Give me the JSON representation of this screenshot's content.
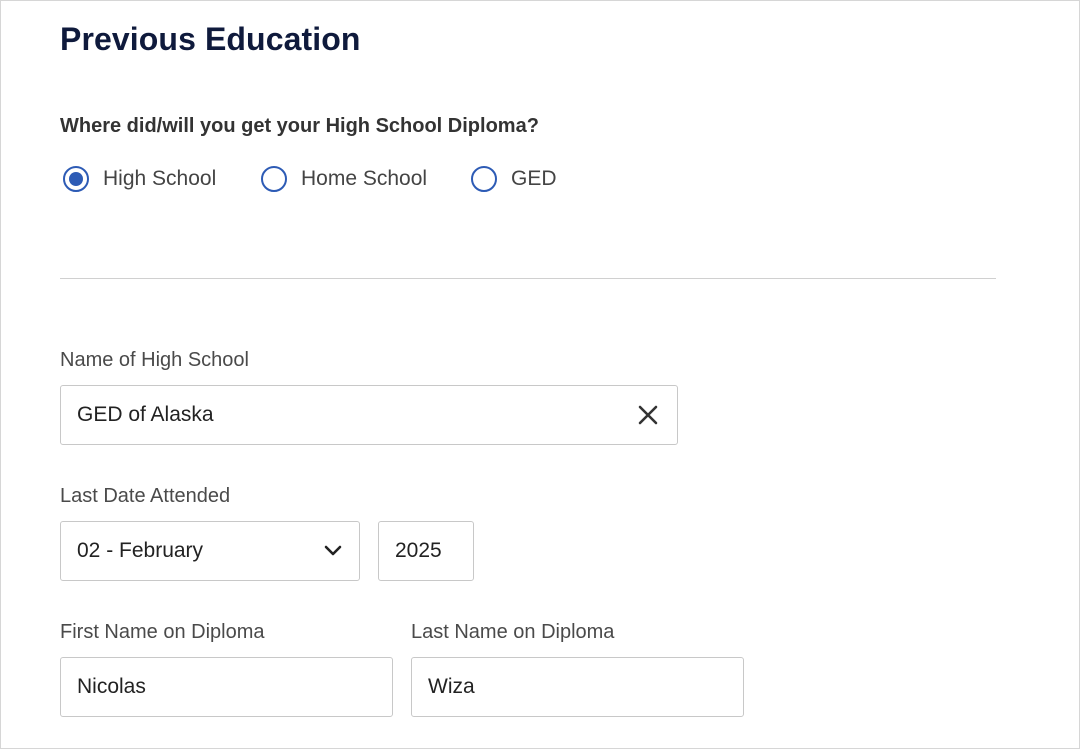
{
  "page": {
    "title": "Previous Education"
  },
  "diploma_question": {
    "label": "Where did/will you get your High School Diploma?",
    "options": [
      {
        "label": "High School",
        "selected": true
      },
      {
        "label": "Home School",
        "selected": false
      },
      {
        "label": "GED",
        "selected": false
      }
    ]
  },
  "school_name": {
    "label": "Name of High School",
    "value": "GED of Alaska",
    "clear_icon": "close-icon"
  },
  "last_date": {
    "label": "Last Date Attended",
    "month_value": "02 - February",
    "month_icon": "chevron-down-icon",
    "year_value": "2025"
  },
  "first_name": {
    "label": "First Name on Diploma",
    "value": "Nicolas"
  },
  "last_name": {
    "label": "Last Name on Diploma",
    "value": "Wiza"
  },
  "colors": {
    "title": "#0f1a3c",
    "accent": "#2d5bb5",
    "border": "#c8c8c8",
    "divider": "#d0d0d0"
  }
}
